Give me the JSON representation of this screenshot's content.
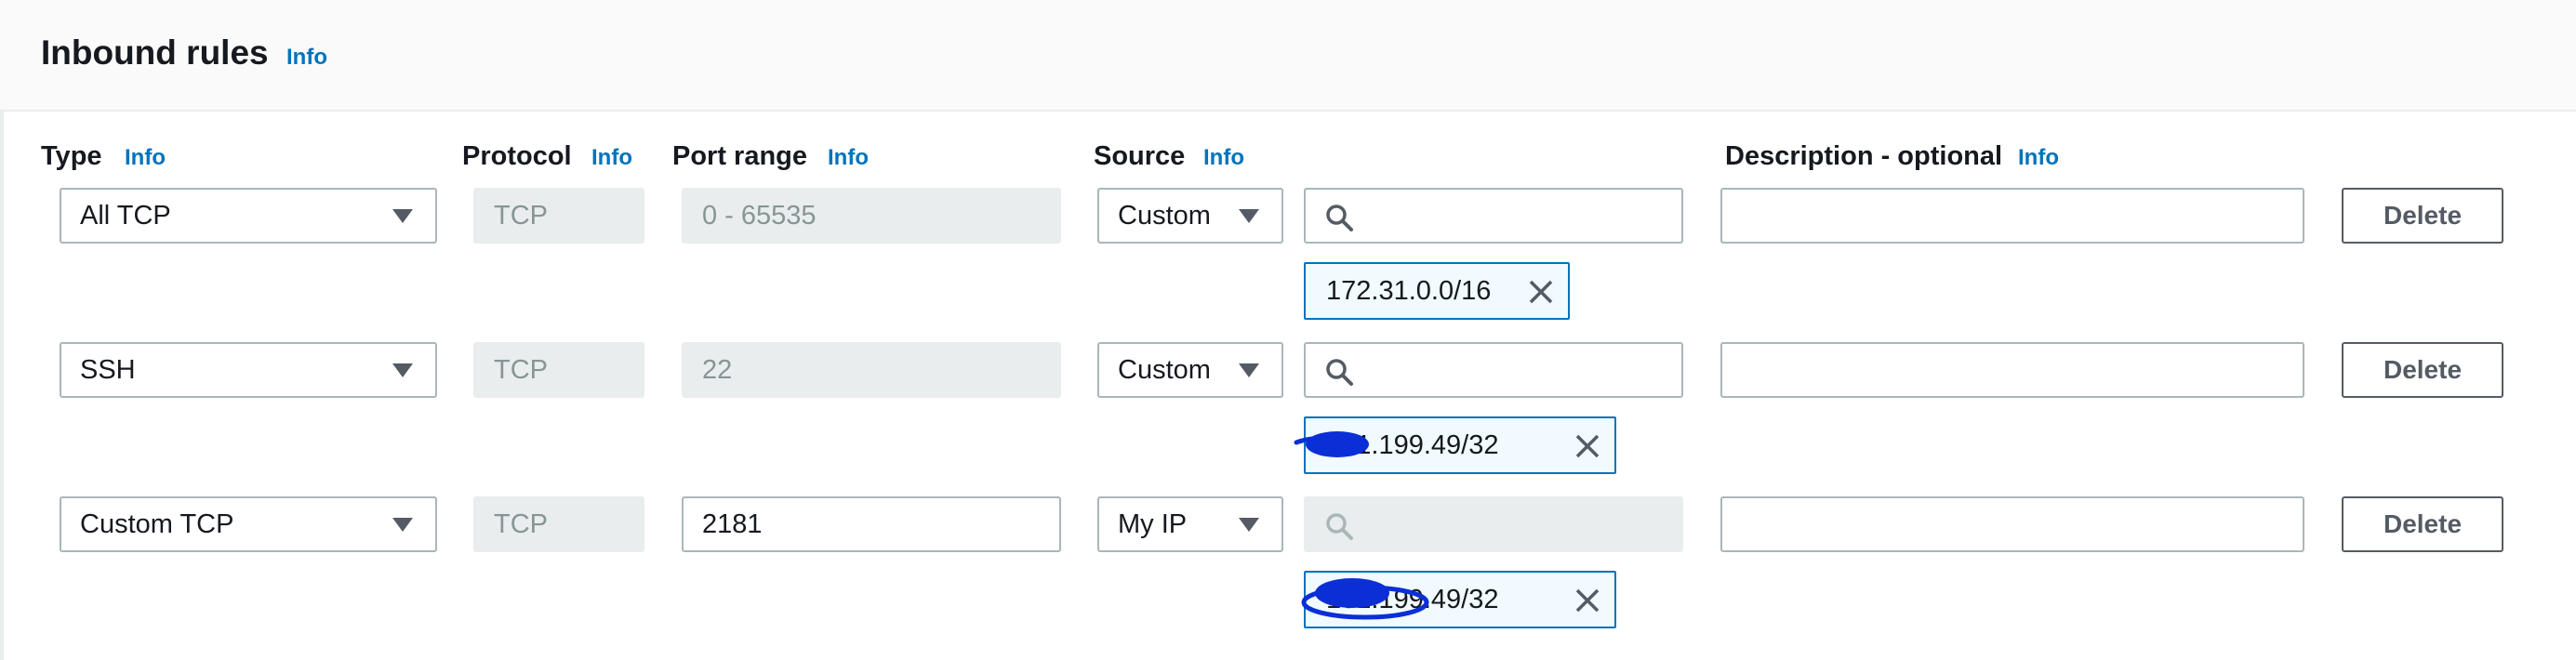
{
  "section": {
    "title": "Inbound rules",
    "info": "Info"
  },
  "columns": {
    "type": {
      "label": "Type",
      "info": "Info"
    },
    "protocol": {
      "label": "Protocol",
      "info": "Info"
    },
    "port_range": {
      "label": "Port range",
      "info": "Info"
    },
    "source": {
      "label": "Source",
      "info": "Info"
    },
    "description": {
      "label": "Description - optional",
      "info": "Info"
    }
  },
  "rules": [
    {
      "type": "All TCP",
      "protocol": "TCP",
      "port_range": "0 - 65535",
      "port_editable": false,
      "source_mode": "Custom",
      "source_search_enabled": true,
      "source_token": "172.31.0.0/16",
      "description": "",
      "delete_label": "Delete"
    },
    {
      "type": "SSH",
      "protocol": "TCP",
      "port_range": "22",
      "port_editable": false,
      "source_mode": "Custom",
      "source_search_enabled": true,
      "source_token": "101.199.49/32",
      "description": "",
      "delete_label": "Delete"
    },
    {
      "type": "Custom TCP",
      "protocol": "TCP",
      "port_range": "2181",
      "port_editable": true,
      "source_mode": "My IP",
      "source_search_enabled": false,
      "source_token": "101.199.49/32",
      "description": "",
      "delete_label": "Delete"
    }
  ],
  "colors": {
    "accent": "#0073bb",
    "redaction": "#0b2fd6"
  },
  "icons": {
    "search": "search-icon",
    "remove": "close-icon",
    "dropdown": "caret-down-icon"
  }
}
